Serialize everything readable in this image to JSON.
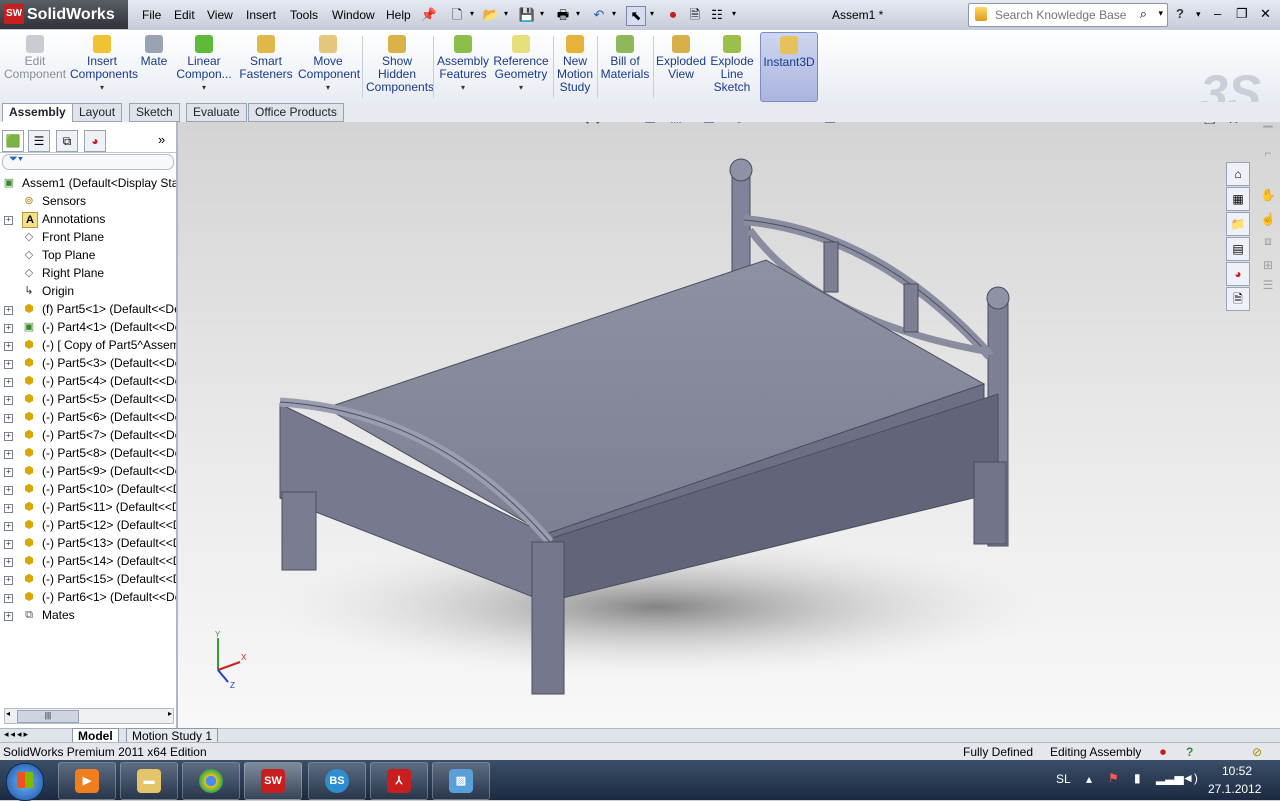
{
  "app": {
    "name": "SolidWorks",
    "badge": "SW",
    "doc_title": "Assem1 *"
  },
  "menu": [
    "File",
    "Edit",
    "View",
    "Insert",
    "Tools",
    "Window",
    "Help"
  ],
  "search": {
    "placeholder": "Search Knowledge Base"
  },
  "help_glyph": "?",
  "ribbon": [
    {
      "label": "Edit\nComponent",
      "disabled": true
    },
    {
      "label": "Insert\nComponents"
    },
    {
      "label": "Mate"
    },
    {
      "label": "Linear\nCompon..."
    },
    {
      "label": "Smart\nFasteners"
    },
    {
      "label": "Move\nComponent"
    },
    {
      "label": "Show\nHidden\nComponents"
    },
    {
      "label": "Assembly\nFeatures"
    },
    {
      "label": "Reference\nGeometry"
    },
    {
      "label": "New\nMotion\nStudy"
    },
    {
      "label": "Bill of\nMaterials"
    },
    {
      "label": "Exploded\nView"
    },
    {
      "label": "Explode\nLine\nSketch"
    },
    {
      "label": "Instant3D"
    }
  ],
  "command_tabs": [
    "Assembly",
    "Layout",
    "Sketch",
    "Evaluate",
    "Office Products"
  ],
  "tree": {
    "root": "Assem1  (Default<Display State",
    "items": [
      "Sensors",
      "Annotations",
      "Front Plane",
      "Top Plane",
      "Right Plane",
      "Origin",
      "(f) Part5<1> (Default<<Def",
      "(-) Part4<1> (Default<<Def",
      "(-) [ Copy of Part5^Assem",
      "(-) Part5<3> (Default<<Def",
      "(-) Part5<4> (Default<<Def",
      "(-) Part5<5> (Default<<Def",
      "(-) Part5<6> (Default<<Def",
      "(-) Part5<7> (Default<<Def",
      "(-) Part5<8> (Default<<Def",
      "(-) Part5<9> (Default<<Def",
      "(-) Part5<10> (Default<<D",
      "(-) Part5<11> (Default<<D",
      "(-) Part5<12> (Default<<D",
      "(-) Part5<13> (Default<<D",
      "(-) Part5<14> (Default<<D",
      "(-) Part5<15> (Default<<D",
      "(-) Part6<1> (Default<<Def",
      "Mates"
    ]
  },
  "bottom_tabs": [
    "Model",
    "Motion Study 1"
  ],
  "status": {
    "edition": "SolidWorks Premium 2011 x64 Edition",
    "defined": "Fully Defined",
    "mode": "Editing Assembly"
  },
  "triad": {
    "x": "X",
    "y": "Y",
    "z": "Z"
  },
  "taskbar": {
    "lang": "SL",
    "time": "10:52",
    "date": "27.1.2012",
    "badges": [
      "SW",
      "BS"
    ]
  },
  "colors": {
    "accent": "#2f62c9",
    "model": "#7c7f90",
    "brand": "#c81e1e"
  }
}
